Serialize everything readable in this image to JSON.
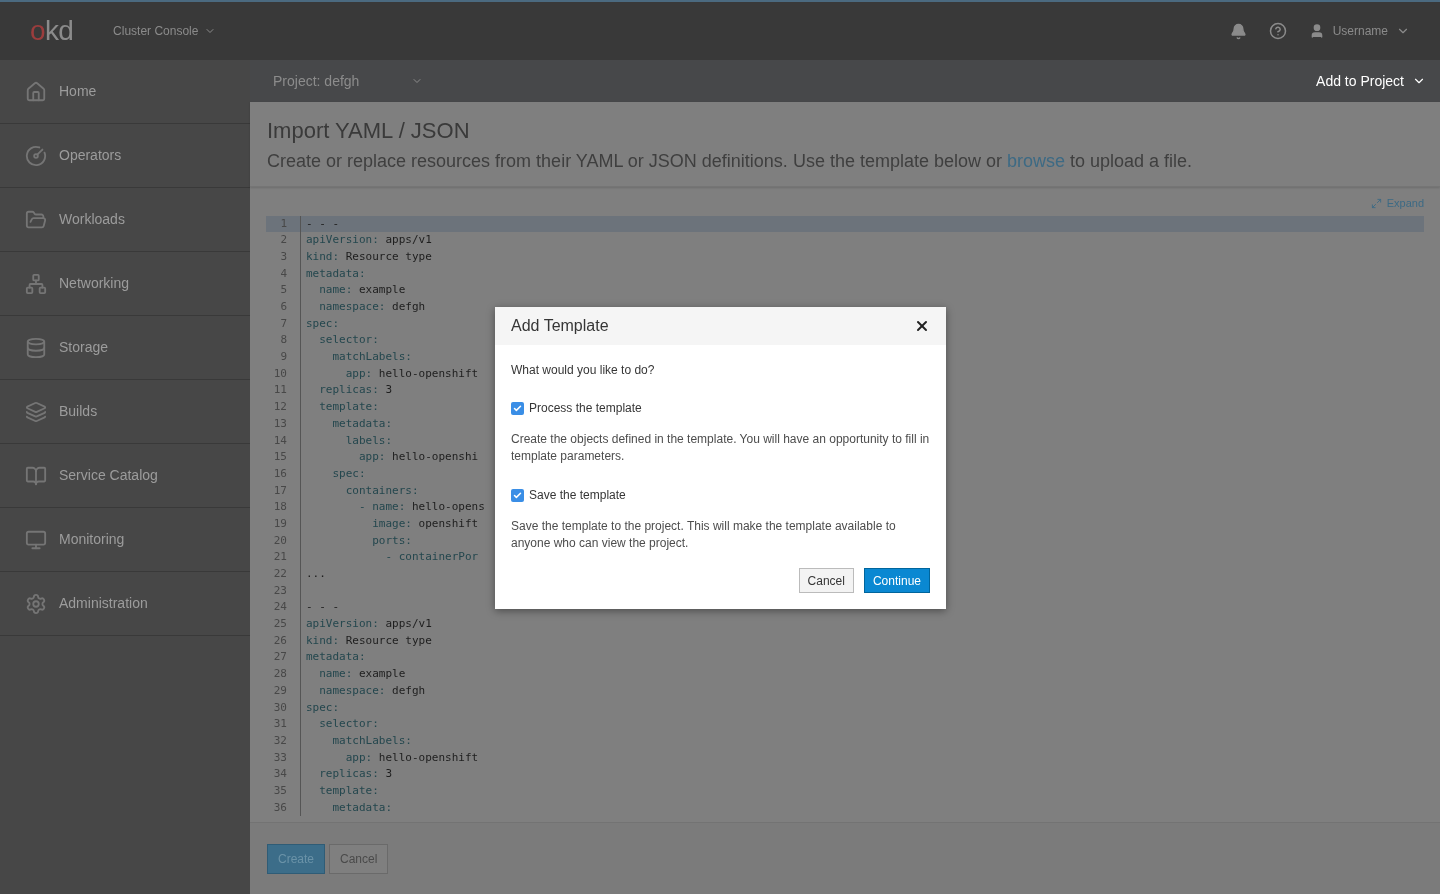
{
  "masthead": {
    "logo": {
      "accent": "o",
      "rest": "kd"
    },
    "console_switcher": "Cluster Console",
    "user": "Username"
  },
  "sidebar": {
    "items": [
      {
        "label": "Home",
        "selected": false
      },
      {
        "label": "Operators",
        "selected": false
      },
      {
        "label": "Workloads",
        "selected": false
      },
      {
        "label": "Networking",
        "selected": false
      },
      {
        "label": "Storage",
        "selected": false
      },
      {
        "label": "Builds",
        "selected": false
      },
      {
        "label": "Service Catalog",
        "selected": false
      },
      {
        "label": "Monitoring",
        "selected": false
      },
      {
        "label": "Administration",
        "selected": false
      }
    ]
  },
  "project_bar": {
    "project": "Project: defgh",
    "add_button": "Add to Project"
  },
  "page": {
    "title": "Import YAML / JSON",
    "subtitle": {
      "before": "Create or replace resources from their YAML or JSON definitions. Use the template below or ",
      "link": "browse",
      "after": " to upload a file."
    },
    "expand": "Expand"
  },
  "editor": {
    "lines": [
      {
        "number": "1",
        "value": "- - -",
        "highlighted": true
      },
      {
        "number": "2",
        "key": "apiVersion:",
        "value": " apps/v1",
        "highlighted": false
      },
      {
        "number": "3",
        "key": "kind:",
        "value": " Resource type",
        "highlighted": false
      },
      {
        "number": "4",
        "key": "metadata:",
        "highlighted": false
      },
      {
        "number": "5",
        "key": "  name:",
        "value": " example",
        "highlighted": false
      },
      {
        "number": "6",
        "key": "  namespace:",
        "value": " defgh",
        "highlighted": false
      },
      {
        "number": "7",
        "key": "spec:",
        "highlighted": false
      },
      {
        "number": "8",
        "key": "  selector:",
        "highlighted": false
      },
      {
        "number": "9",
        "key": "    matchLabels:",
        "highlighted": false
      },
      {
        "number": "10",
        "key": "      app:",
        "value": " hello-openshift",
        "highlighted": false
      },
      {
        "number": "11",
        "key": "  replicas:",
        "value": " 3",
        "highlighted": false
      },
      {
        "number": "12",
        "key": "  template:",
        "highlighted": false
      },
      {
        "number": "13",
        "key": "    metadata:",
        "highlighted": false
      },
      {
        "number": "14",
        "key": "      labels:",
        "highlighted": false
      },
      {
        "number": "15",
        "key": "        app:",
        "value": " hello-openshi",
        "highlighted": false
      },
      {
        "number": "16",
        "key": "    spec:",
        "highlighted": false
      },
      {
        "number": "17",
        "key": "      containers:",
        "highlighted": false
      },
      {
        "number": "18",
        "key": "        - name:",
        "value": " hello-opens",
        "highlighted": false
      },
      {
        "number": "19",
        "key": "          image:",
        "value": " openshift",
        "highlighted": false
      },
      {
        "number": "20",
        "key": "          ports:",
        "highlighted": false
      },
      {
        "number": "21",
        "key": "            - containerPor",
        "highlighted": false
      },
      {
        "number": "22",
        "value": "...",
        "highlighted": false
      },
      {
        "number": "23",
        "highlighted": false
      },
      {
        "number": "24",
        "value": "- - -",
        "highlighted": false
      },
      {
        "number": "25",
        "key": "apiVersion:",
        "value": " apps/v1",
        "highlighted": false
      },
      {
        "number": "26",
        "key": "kind:",
        "value": " Resource type",
        "highlighted": false
      },
      {
        "number": "27",
        "key": "metadata:",
        "highlighted": false
      },
      {
        "number": "28",
        "key": "  name:",
        "value": " example",
        "highlighted": false
      },
      {
        "number": "29",
        "key": "  namespace:",
        "value": " defgh",
        "highlighted": false
      },
      {
        "number": "30",
        "key": "spec:",
        "highlighted": false
      },
      {
        "number": "31",
        "key": "  selector:",
        "highlighted": false
      },
      {
        "number": "32",
        "key": "    matchLabels:",
        "highlighted": false
      },
      {
        "number": "33",
        "key": "      app:",
        "value": " hello-openshift",
        "highlighted": false
      },
      {
        "number": "34",
        "key": "  replicas:",
        "value": " 3",
        "highlighted": false
      },
      {
        "number": "35",
        "key": "  template:",
        "highlighted": false
      },
      {
        "number": "36",
        "key": "    metadata:",
        "highlighted": false
      }
    ]
  },
  "footer": {
    "buttons": [
      {
        "label": "Create",
        "kind": "primary"
      },
      {
        "label": "Cancel",
        "kind": "default"
      }
    ]
  },
  "dialog": {
    "title": "Add Template",
    "question": "What would you like to do?",
    "options": [
      {
        "label": "Process the template",
        "checked": true,
        "help": "Create the objects defined in the template. You will have an opportunity to fill in template parameters."
      },
      {
        "label": "Save the template",
        "checked": true,
        "help": "Save the template to the project. This will make the template available to anyone who can view the project."
      }
    ],
    "buttons": [
      {
        "label": "Cancel",
        "kind": "default"
      },
      {
        "label": "Continue",
        "kind": "primary"
      }
    ]
  }
}
